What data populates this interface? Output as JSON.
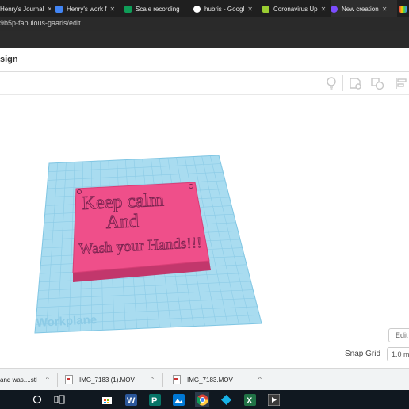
{
  "browser": {
    "tabs": [
      {
        "label": "Henry's Journal",
        "color": "#4285f4",
        "icon": "docs-icon"
      },
      {
        "label": "Henry's work f",
        "color": "#4285f4",
        "icon": "docs-icon"
      },
      {
        "label": "Scale recording",
        "color": "#0f9d58",
        "icon": "sheets-icon"
      },
      {
        "label": "hubris - Googl",
        "color": "#ffffff",
        "icon": "google-icon"
      },
      {
        "label": "Coronavirus Up",
        "color": "#9acd32",
        "icon": "classroom-icon"
      },
      {
        "label": "New creation",
        "color": "#7c4dff",
        "icon": "tinkercad-icon"
      }
    ],
    "url": "9b5p-fabulous-gaaris/edit"
  },
  "app": {
    "title": "sign",
    "toolbar_icons": [
      "lightbulb-icon",
      "notes-icon",
      "shapes-icon",
      "align-icon"
    ]
  },
  "canvas": {
    "workplane_label": "Workplane",
    "model": {
      "line1": "Keep calm",
      "line2": "And",
      "line3": "Wash your Hands!!!"
    },
    "edit_label": "Edit",
    "snap_grid_label": "Snap Grid",
    "snap_grid_value": "1.0 m"
  },
  "downloads": [
    {
      "label": "and was....stl"
    },
    {
      "label": "IMG_7183 (1).MOV"
    },
    {
      "label": "IMG_7183.MOV"
    }
  ],
  "taskbar": [
    "search-icon",
    "task-view-icon",
    "store-icon",
    "word-icon",
    "publisher-icon",
    "photos-icon",
    "chrome-icon",
    "kodi-icon",
    "excel-icon",
    "media-icon"
  ],
  "colors": {
    "workplane": "#a9dcf0",
    "grid_line": "#7cc4e2",
    "model_fill": "#ef4f8a",
    "model_side": "#c2376c",
    "text": "#7a2450"
  }
}
